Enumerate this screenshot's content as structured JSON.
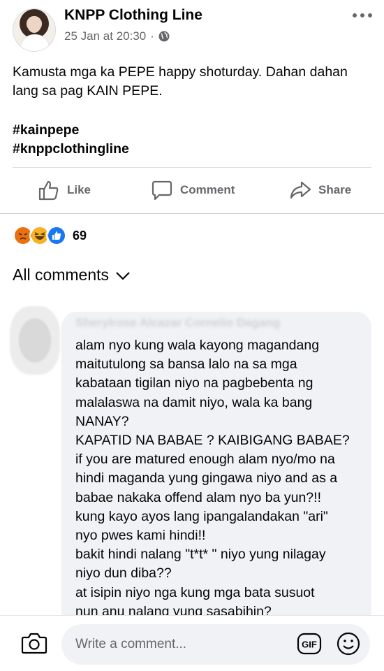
{
  "post": {
    "author": "KNPP Clothing Line",
    "timestamp": "25 Jan at 20:30",
    "separator": "·",
    "body_line1": "Kamusta mga ka PEPE happy shoturday. Dahan dahan",
    "body_line2": "lang sa pag KAIN PEPE.",
    "hashtags": [
      "#kainpepe",
      "#knppclothingline"
    ]
  },
  "actions": {
    "like": "Like",
    "comment": "Comment",
    "share": "Share"
  },
  "reactions": {
    "types": [
      "angry",
      "haha",
      "like"
    ],
    "count": "69"
  },
  "comments_filter": "All comments",
  "comment": {
    "author_blurred": "Sherylrose Alcazar Cornelio Dagang",
    "lines": [
      "alam nyo kung wala kayong magandang",
      "maitutulong sa bansa lalo na sa mga",
      "kabataan tigilan niyo na pagbebenta ng",
      "malalaswa na damit niyo, wala ka bang",
      "NANAY?",
      "KAPATID NA BABAE ? KAIBIGANG BABAE?",
      "if you are matured enough alam nyo/mo na",
      "hindi maganda yung gingawa niyo and as a",
      "babae nakaka offend alam nyo ba yun?!!",
      "kung kayo ayos lang ipangalandakan \"ari\"",
      "nyo pwes kami hindi!!",
      "bakit hindi nalang \"t*t* \" niyo yung nilagay",
      "niyo dun diba??",
      "at isipin niyo nga kung mga bata susuot",
      "nun anu nalang yung sasabihin?"
    ]
  },
  "composer": {
    "placeholder": "Write a comment...",
    "gif_label": "GIF"
  },
  "colors": {
    "secondary_text": "#65676b",
    "bubble_bg": "#f0f2f5",
    "like_blue": "#1877f2",
    "angry_orange": "#e9710f",
    "haha_yellow": "#f7b125"
  }
}
